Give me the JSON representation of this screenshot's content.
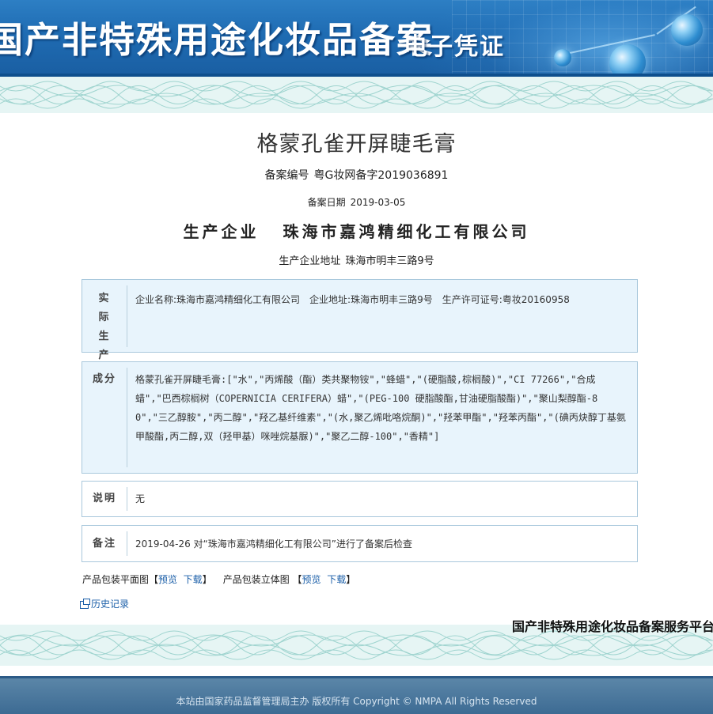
{
  "header": {
    "title": "国产非特殊用途化妆品备案",
    "subtitle": "电子凭证"
  },
  "product": {
    "name": "格蒙孔雀开屏睫毛膏",
    "reg_no_label": "备案编号",
    "reg_no": "粤G妆网备字2019036891",
    "reg_date_label": "备案日期",
    "reg_date": "2019-03-05",
    "company_label": "生产企业",
    "company": "珠海市嘉鸿精细化工有限公司",
    "address_label": "生产企业地址",
    "address": "珠海市明丰三路9号"
  },
  "details": {
    "producer": {
      "label": "实际生产企业",
      "value": "企业名称:珠海市嘉鸿精细化工有限公司　企业地址:珠海市明丰三路9号　生产许可证号:粤妆20160958"
    },
    "ingredients": {
      "label": "成分",
      "value": "格蒙孔雀开屏睫毛膏:[\"水\",\"丙烯酸（酯）类共聚物铵\",\"蜂蜡\",\"(硬脂酸,棕榈酸)\",\"CI 77266\",\"合成蜡\",\"巴西棕榈树（COPERNICIA CERIFERA）蜡\",\"(PEG-100 硬脂酸酯,甘油硬脂酸酯)\",\"聚山梨醇酯-80\",\"三乙醇胺\",\"丙二醇\",\"羟乙基纤维素\",\"(水,聚乙烯吡咯烷酮)\",\"羟苯甲酯\",\"羟苯丙酯\",\"(碘丙炔醇丁基氨甲酸酯,丙二醇,双（羟甲基）咪唑烷基脲)\",\"聚乙二醇-100\",\"香精\"]"
    },
    "note": {
      "label": "说明",
      "value": "无"
    },
    "remark": {
      "label": "备注",
      "value": "2019-04-26 对“珠海市嘉鸿精细化工有限公司”进行了备案后检查"
    }
  },
  "packaging": {
    "flat_label": "产品包装平面图【",
    "preview": "预览",
    "download": "下载",
    "close": "】",
    "solid_label": "产品包装立体图 【"
  },
  "history": "历史记录",
  "platform_name": "国产非特殊用途化妆品备案服务平台",
  "footer": "本站由国家药品监督管理局主办 版权所有 Copyright © NMPA All Rights Reserved"
}
